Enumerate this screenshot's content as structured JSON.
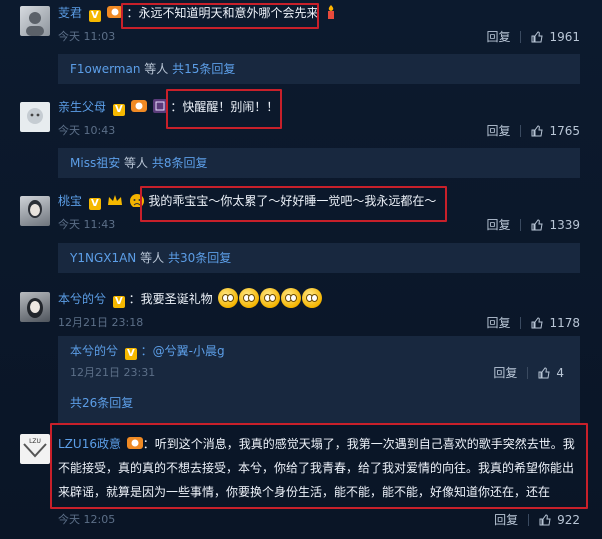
{
  "comments": [
    {
      "user": "芰君",
      "text": "：永远不知道明天和意外哪个会先来",
      "time": "今天 11:03",
      "reply_label": "回复",
      "likes": "1961",
      "thread": {
        "user": "F1owerman",
        "middle": "等人",
        "count": "共15条回复"
      }
    },
    {
      "user": "亲生父母",
      "text": "：快醒醒！别闹！！",
      "time": "今天 10:43",
      "reply_label": "回复",
      "likes": "1765",
      "thread": {
        "user": "Miss祖安",
        "middle": "等人",
        "count": "共8条回复"
      }
    },
    {
      "user": "桃宝",
      "text": "我的乖宝宝～你太累了～好好睡一觉吧～我永远都在～",
      "time": "今天 11:43",
      "reply_label": "回复",
      "likes": "1339",
      "thread": {
        "user": "Y1NGX1AN",
        "middle": "等人",
        "count": "共30条回复"
      }
    },
    {
      "user": "本兮的兮",
      "text": "：我要圣诞礼物",
      "time": "12月21日 23:18",
      "reply_label": "回复",
      "likes": "1178",
      "subreply": {
        "user": "本兮的兮",
        "text": "：@兮翼-小晨g",
        "time": "12月21日 23:31",
        "reply_label": "回复",
        "likes": "4"
      },
      "thread_count": "共26条回复"
    },
    {
      "user": "LZU16政意",
      "text": "：听到这个消息，我真的感觉天塌了，我第一次遇到自己喜欢的歌手突然去世。我不能接受，真的真的不想去接受，本兮，你给了我青春，给了我对爱情的向往。我真的希望你能出来辟谣，就算是因为一些事情，你要换个身份生活，能不能，能不能，好像知道你还在，还在",
      "line1": "：听到这个消息，我真的感觉天塌了，我第一次遇到自己喜欢的歌手突然去世。我",
      "line2": "不能接受，真的真的不想去接受，本兮，你给了我青春，给了我对爱情的向往。我真的希望你能出",
      "line3": "来辟谣，就算是因为一些事情，你要换个身份生活，能不能，能不能，好像知道你还在，还在",
      "time": "今天 12:05",
      "reply_label": "回复",
      "likes": "922"
    }
  ],
  "colors": {
    "background": "#0b1628",
    "link": "#5c9ee7",
    "highlight": "#c8202a",
    "meta": "#5c6f88"
  }
}
